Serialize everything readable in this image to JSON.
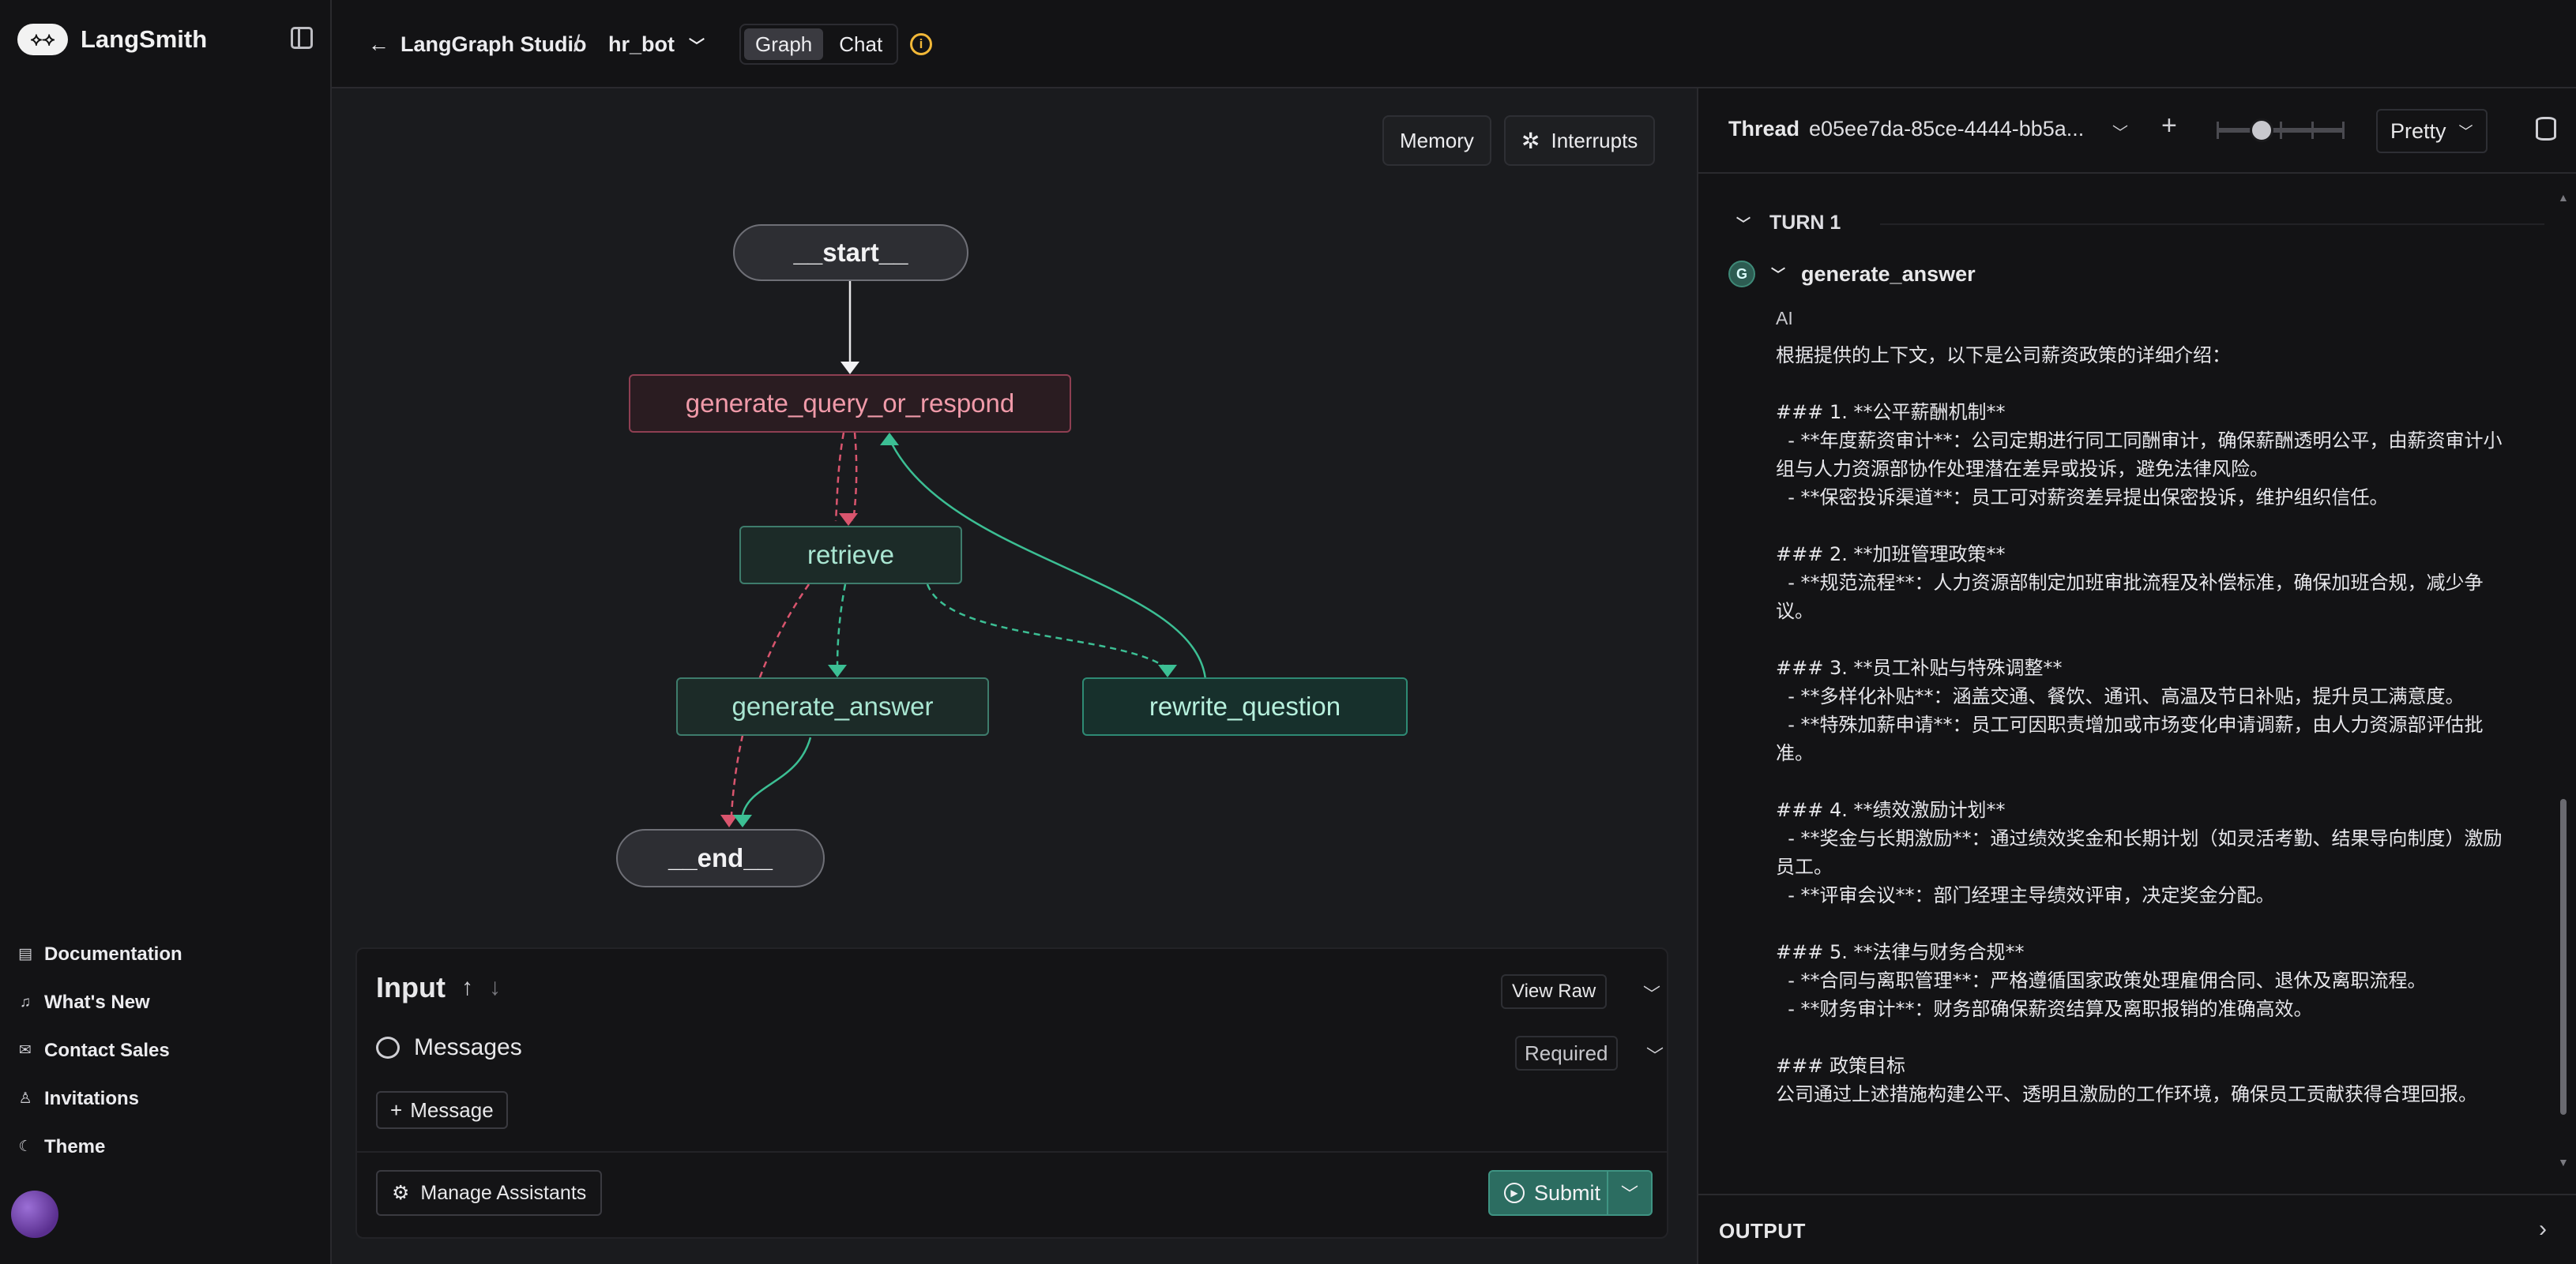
{
  "sidebar": {
    "brand": "LangSmith",
    "brand_logo": "🦜🔗",
    "nav": [
      {
        "label": "Documentation",
        "icon": "document-icon"
      },
      {
        "label": "What's New",
        "icon": "bell-icon"
      },
      {
        "label": "Contact Sales",
        "icon": "mail-icon"
      },
      {
        "label": "Invitations",
        "icon": "user-plus-icon"
      },
      {
        "label": "Theme",
        "icon": "moon-icon"
      }
    ]
  },
  "topbar": {
    "back_label": "LangGraph Studio",
    "separator": "/",
    "graph_name": "hr_bot",
    "tabs": [
      {
        "label": "Graph",
        "active": true
      },
      {
        "label": "Chat",
        "active": false
      }
    ]
  },
  "canvas": {
    "memory_label": "Memory",
    "interrupts_label": "Interrupts",
    "nodes": {
      "start": "__start__",
      "generate_query": "generate_query_or_respond",
      "retrieve": "retrieve",
      "generate_answer": "generate_answer",
      "rewrite_question": "rewrite_question",
      "end": "__end__"
    }
  },
  "input_panel": {
    "title": "Input",
    "view_raw": "View Raw",
    "messages_label": "Messages",
    "required": "Required",
    "add_message": "Message",
    "manage_assistants": "Manage Assistants",
    "submit": "Submit"
  },
  "thread_panel": {
    "thread_label": "Thread",
    "thread_id": "e05ee7da-85ce-4444-bb5a...",
    "view_mode": "Pretty",
    "turn_label": "TURN 1",
    "node_badge": "G",
    "node_name": "generate_answer",
    "role": "AI",
    "message": "根据提供的上下文，以下是公司薪资政策的详细介绍：\n\n### 1. **公平薪酬机制**\n  - **年度薪资审计**：公司定期进行同工同酬审计，确保薪酬透明公平，由薪资审计小组与人力资源部协作处理潜在差异或投诉，避免法律风险。\n  - **保密投诉渠道**：员工可对薪资差异提出保密投诉，维护组织信任。\n\n### 2. **加班管理政策**\n  - **规范流程**：人力资源部制定加班审批流程及补偿标准，确保加班合规，减少争议。\n\n### 3. **员工补贴与特殊调整**\n  - **多样化补贴**：涵盖交通、餐饮、通讯、高温及节日补贴，提升员工满意度。\n  - **特殊加薪申请**：员工可因职责增加或市场变化申请调薪，由人力资源部评估批准。\n\n### 4. **绩效激励计划**\n  - **奖金与长期激励**：通过绩效奖金和长期计划（如灵活考勤、结果导向制度）激励员工。\n  - **评审会议**：部门经理主导绩效评审，决定奖金分配。\n\n### 5. **法律与财务合规**\n  - **合同与离职管理**：严格遵循国家政策处理雇佣合同、退休及离职流程。\n  - **财务审计**：财务部确保薪资结算及离职报销的准确高效。\n\n### 政策目标\n公司通过上述措施构建公平、透明且激励的工作环境，确保员工贡献获得合理回报。",
    "output_label": "OUTPUT"
  },
  "colors": {
    "accent_green": "#2c6d61",
    "node_pink": "#f09aa9",
    "edge_pink": "#d9556e",
    "edge_green": "#3cbf94",
    "warning": "#f2b838"
  }
}
